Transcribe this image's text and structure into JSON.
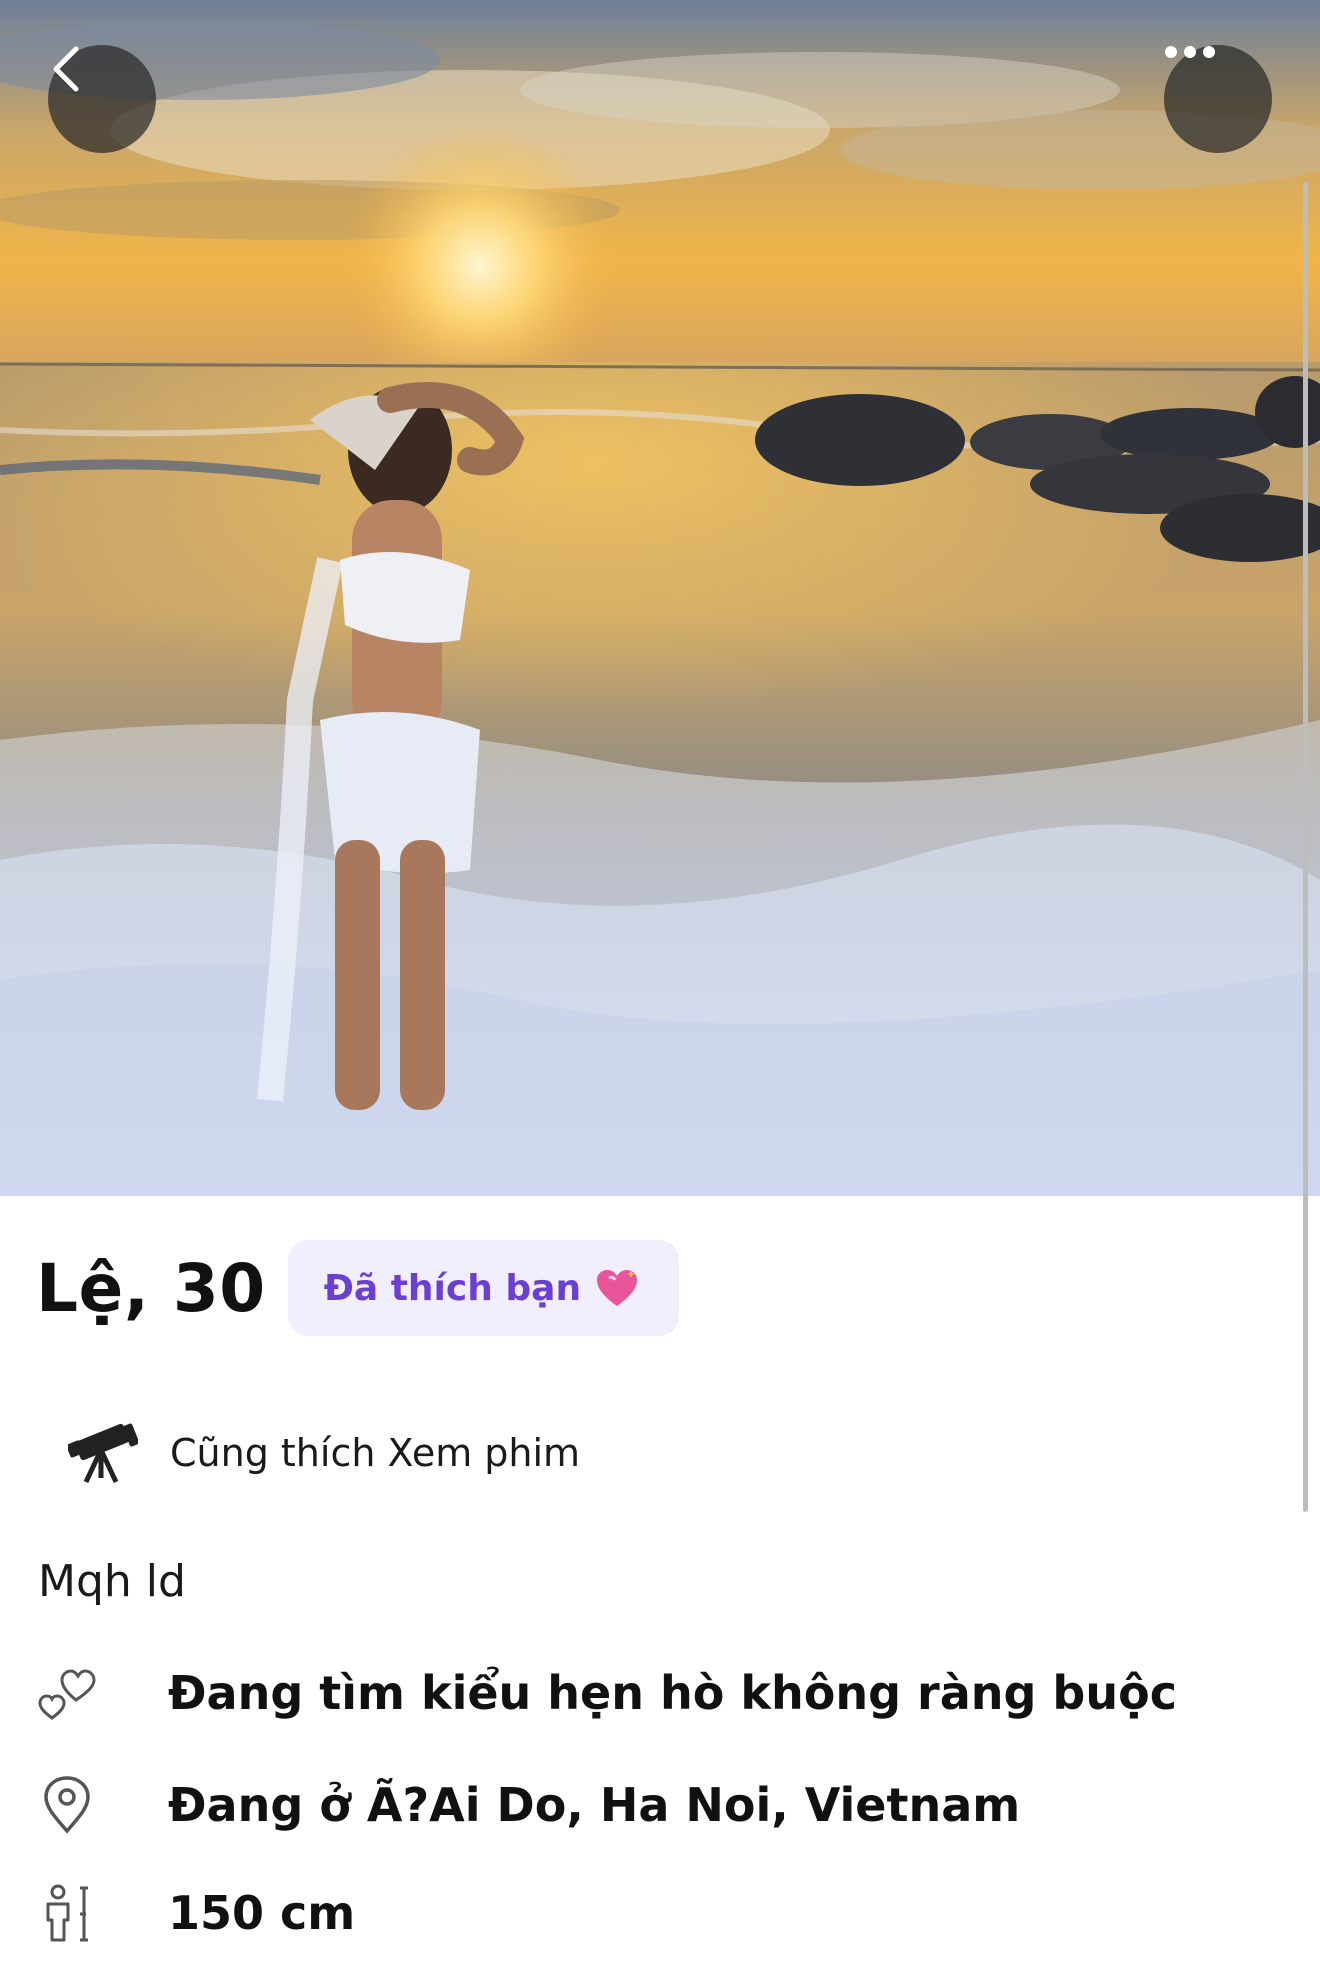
{
  "photo": {
    "description_icon": "profile-photo"
  },
  "nav": {
    "back_icon": "chevron-left-icon",
    "more_icon": "more-horizontal-icon"
  },
  "profile": {
    "name_age": "Lệ, 30",
    "liked_badge": "Đã thích bạn",
    "liked_badge_color": "#6c3fd3",
    "liked_badge_bg": "#f1eefd",
    "common_interest": "Cũng thích Xem phim",
    "bio": "Mqh ld"
  },
  "details": [
    {
      "icon": "hearts-icon",
      "text": "Đang tìm kiểu hẹn hò không ràng buộc"
    },
    {
      "icon": "location-pin-icon",
      "text": "Đang ở Ã?Ai Do, Ha Noi, Vietnam"
    },
    {
      "icon": "height-icon",
      "text": "150 cm"
    }
  ]
}
